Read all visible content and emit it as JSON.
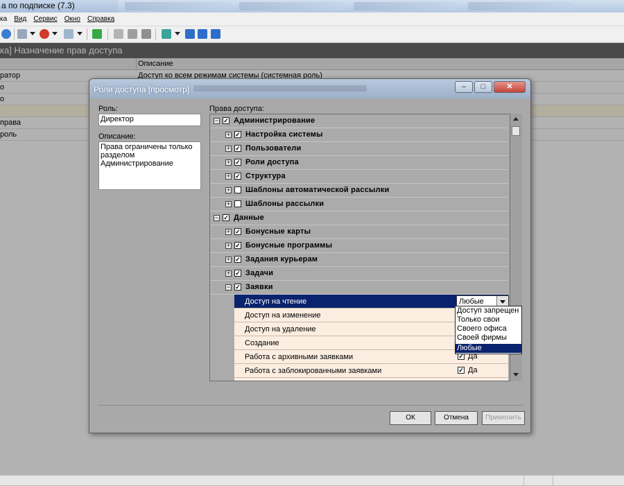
{
  "app": {
    "title": "а по подписке (7.3)",
    "menu": [
      {
        "key": "menu_file",
        "label": "ка"
      },
      {
        "key": "menu_view",
        "label": "Вид"
      },
      {
        "key": "menu_service",
        "label": "Сервис"
      },
      {
        "key": "menu_window",
        "label": "Окно"
      },
      {
        "key": "menu_help",
        "label": "Справка"
      }
    ],
    "document_title": "ка] Назначение прав доступа",
    "grid": {
      "column_description": "Описание",
      "rows": [
        {
          "name": "ратор",
          "description": "Доступ ко всем режимам системы (системная роль)"
        },
        {
          "name": "о",
          "description": ""
        },
        {
          "name": "о",
          "description": ""
        },
        {
          "name": "",
          "description": ""
        },
        {
          "name": "права",
          "description": ""
        },
        {
          "name": "роль",
          "description": ""
        }
      ]
    }
  },
  "dialog": {
    "title": "Роли доступа [просмотр]",
    "role_label": "Роль:",
    "role_value": "Директор",
    "description_label": "Описание:",
    "description_lines": [
      "Права ограничены только",
      "разделом",
      "Администрирование"
    ],
    "rights_label": "Права доступа:",
    "buttons": {
      "ok": "ОК",
      "cancel": "Отмена",
      "apply": "Применить"
    },
    "tree": {
      "admin": {
        "label": "Администрирование",
        "checked": true,
        "expanded": true
      },
      "admin_items": [
        {
          "label": "Настройка системы",
          "checked": true
        },
        {
          "label": "Пользователи",
          "checked": true
        },
        {
          "label": "Роли доступа",
          "checked": true
        },
        {
          "label": "Структура",
          "checked": true
        },
        {
          "label": "Шаблоны автоматической рассылки",
          "checked": false
        },
        {
          "label": "Шаблоны рассылки",
          "checked": false
        }
      ],
      "data": {
        "label": "Данные",
        "checked": true,
        "expanded": true
      },
      "data_items": [
        {
          "label": "Бонусные карты",
          "checked": true
        },
        {
          "label": "Бонусные программы",
          "checked": true
        },
        {
          "label": "Задания курьерам",
          "checked": true
        },
        {
          "label": "Задачи",
          "checked": true
        },
        {
          "label": "Заявки",
          "checked": true,
          "expanded": true
        }
      ],
      "request_permissions": [
        {
          "label": "Доступ на чтение",
          "value": "Любые"
        },
        {
          "label": "Доступ на изменение",
          "value": ""
        },
        {
          "label": "Доступ на удаление",
          "value": ""
        },
        {
          "label": "Создание",
          "value": ""
        },
        {
          "label": "Работа с архивными заявками",
          "value": "Да"
        },
        {
          "label": "Работа с заблокированными заявками",
          "value": "Да"
        }
      ]
    },
    "combo": {
      "value": "Любые",
      "options": [
        "Доступ запрещен",
        "Только свои",
        "Своего офиса",
        "Своей фирмы",
        "Любые"
      ],
      "selected": "Любые"
    }
  }
}
